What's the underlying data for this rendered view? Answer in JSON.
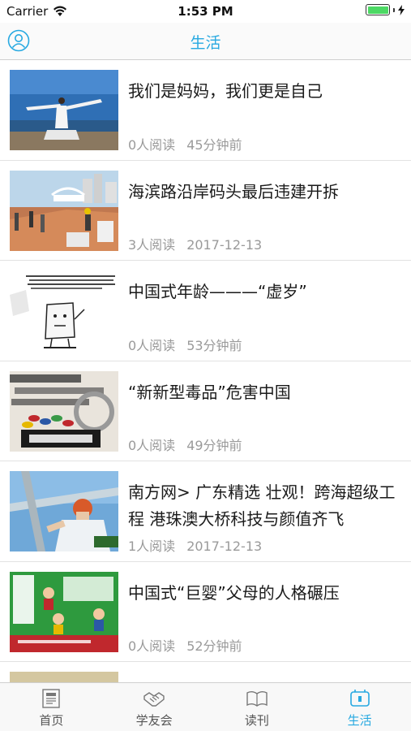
{
  "status_bar": {
    "carrier": "Carrier",
    "time": "1:53 PM",
    "battery_level": 1.0
  },
  "nav": {
    "title": "生活",
    "left_icon": "user-icon",
    "accent": "#27a9e1"
  },
  "articles": [
    {
      "title": "我们是妈妈，我们更是自己",
      "reads": "0人阅读",
      "time": "45分钟前",
      "image": "woman-yoga-seaside"
    },
    {
      "title": "海滨路沿岸码头最后违建开拆",
      "reads": "3人阅读",
      "time": "2017-12-13",
      "image": "waterfront-demolition"
    },
    {
      "title": "中国式年龄———“虚岁”",
      "reads": "0人阅读",
      "time": "53分钟前",
      "image": "cartoon-age-comic"
    },
    {
      "title": "“新新型毒品”危害中国",
      "reads": "0人阅读",
      "time": "49分钟前",
      "image": "drugs-pills"
    },
    {
      "title": "南方网> 广东精选 壮观！跨海超级工程 港珠澳大桥科技与颜值齐飞",
      "reads": "1人阅读",
      "time": "2017-12-13",
      "image": "bridge-worker"
    },
    {
      "title": "中国式“巨婴”父母的人格碾压",
      "reads": "0人阅读",
      "time": "52分钟前",
      "image": "giant-baby-book-cover"
    }
  ],
  "tabs": [
    {
      "label": "首页",
      "icon": "newspaper-icon",
      "active": false
    },
    {
      "label": "学友会",
      "icon": "handshake-icon",
      "active": false
    },
    {
      "label": "读刊",
      "icon": "open-book-icon",
      "active": false
    },
    {
      "label": "生活",
      "icon": "life-icon",
      "active": true
    }
  ]
}
